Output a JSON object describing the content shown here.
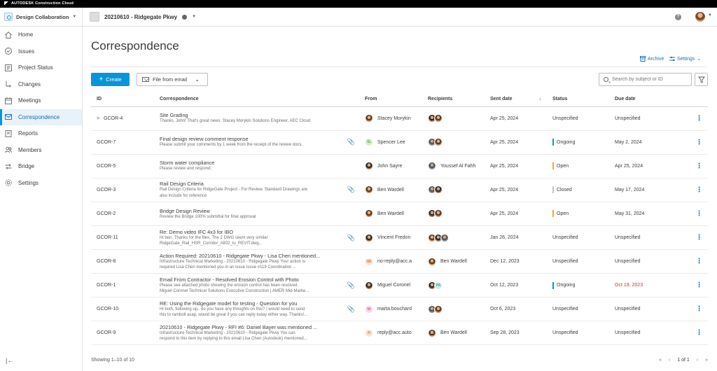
{
  "topbar": {
    "brand": "AUTODESK Construction Cloud"
  },
  "header": {
    "product": "Design Collaboration",
    "project": "20210610 - Ridgegate Pkwy",
    "help": "?"
  },
  "sidebar": {
    "items": [
      {
        "label": "Home",
        "icon": "home-icon"
      },
      {
        "label": "Issues",
        "icon": "issues-icon"
      },
      {
        "label": "Project Status",
        "icon": "project-status-icon"
      },
      {
        "label": "Changes",
        "icon": "changes-icon"
      },
      {
        "label": "Meetings",
        "icon": "meetings-icon"
      },
      {
        "label": "Correspondence",
        "icon": "correspondence-icon",
        "active": true
      },
      {
        "label": "Reports",
        "icon": "reports-icon"
      },
      {
        "label": "Members",
        "icon": "members-icon"
      },
      {
        "label": "Bridge",
        "icon": "bridge-icon"
      },
      {
        "label": "Settings",
        "icon": "settings-icon"
      }
    ],
    "collapse": "|←"
  },
  "main": {
    "title": "Correspondence",
    "archive": "Archive",
    "settings": "Settings",
    "create": "Create",
    "file_from_email": "File from email",
    "search_placeholder": "Search by subject or ID",
    "columns": [
      "ID",
      "Correspondence",
      "From",
      "Recipients",
      "Sent date",
      "Status",
      "Due date"
    ],
    "rows": [
      {
        "id": "GCOR-4",
        "expand": ">",
        "subject": "Site Grading",
        "snippet1": "Thanks, John! That's great news. Stacey Morykin Solutions Engineer, AEC Cloud",
        "snippet2": "",
        "attach": false,
        "from": "Stacey Morykin",
        "from_initials": "",
        "from_av": "photo",
        "recipients": [
          "photo2",
          "photo"
        ],
        "recip_name": "",
        "sent": "Apr 25, 2024",
        "status": "Unspecified",
        "status_color": "",
        "due": "Unspecified",
        "due_overdue": false
      },
      {
        "id": "GCOR-7",
        "expand": "",
        "subject": "Final design review comment response",
        "snippet1": "Please submit your comments by 1 week from the receipt of the review docs.",
        "snippet2": "",
        "attach": true,
        "from": "Spencer Lee",
        "from_initials": "SL",
        "from_av": "init-green",
        "recipients": [
          "photo3",
          "photo"
        ],
        "recip_name": "",
        "sent": "Apr 25, 2024",
        "status": "Ongoing",
        "status_color": "#0696d7",
        "due": "May 2, 2024",
        "due_overdue": false
      },
      {
        "id": "GCOR-5",
        "expand": "",
        "subject": "Storm water compliance",
        "snippet1": "Please review and respond.",
        "snippet2": "",
        "attach": false,
        "from": "John Sayre",
        "from_initials": "",
        "from_av": "photo2",
        "recipients": [
          "photo3"
        ],
        "recip_name": "Youssef Al Fahh",
        "sent": "Apr 25, 2024",
        "status": "Open",
        "status_color": "#f5a623",
        "due": "Apr 25, 2024",
        "due_overdue": false
      },
      {
        "id": "GCOR-3",
        "expand": "",
        "subject": "Rail Design Criteria",
        "snippet1": "Rail Design Criteria for RidgeGate Project - For Review. Standard Drawings are",
        "snippet2": "also include for reference",
        "attach": true,
        "from": "Ben Wardell",
        "from_initials": "",
        "from_av": "photo",
        "recipients": [
          "photo3",
          "photo2"
        ],
        "recip_name": "",
        "sent": "Apr 25, 2024",
        "status": "Closed",
        "status_color": "#c4c4c4",
        "due": "May 17, 2024",
        "due_overdue": false
      },
      {
        "id": "GCOR-2",
        "expand": "",
        "subject": "Bridge Design Review",
        "snippet1": "Review the Bridge 100% submittal for final approval",
        "snippet2": "",
        "attach": false,
        "from": "Ben Wardell",
        "from_initials": "",
        "from_av": "photo",
        "recipients": [
          "photo2",
          "photo"
        ],
        "recip_name": "",
        "sent": "Apr 25, 2024",
        "status": "Open",
        "status_color": "#f5a623",
        "due": "May 31, 2024",
        "due_overdue": false
      },
      {
        "id": "GCOR-11",
        "expand": "",
        "subject": "Re: Demo video IFC 4x3 for IBO",
        "snippet1": "Hi ben, Thanks for the files. The 2 DWG seem very similar",
        "snippet2": "RidgeGate_Rail_HSR_Corridor_Alt02_to_REVIT.dwg...",
        "attach": true,
        "from": "Vincent Fredon",
        "from_initials": "",
        "from_av": "photo2",
        "recipients": [
          "photo",
          "photo2",
          "photo3"
        ],
        "recip_name": "",
        "sent": "Jan 26, 2024",
        "status": "Unspecified",
        "status_color": "",
        "due": "Unspecified",
        "due_overdue": false
      },
      {
        "id": "GCOR-8",
        "expand": "",
        "subject": "Action Required: 20210610 - Ridgegate Pkwy - Lisa Chen mentioned...",
        "snippet1": "Infrastructure Technical Marketing - 20210610 - Ridgegate Pkwy Your action is",
        "snippet2": "required Lisa Chen mentioned you in an issue  Issue #119 Coordination ...",
        "attach": false,
        "from": "no-reply@acc.a",
        "from_initials": "NR",
        "from_av": "init-orange",
        "recipients": [
          "photo"
        ],
        "recip_name": "Ben Wardell",
        "sent": "Dec 12, 2023",
        "status": "Unspecified",
        "status_color": "",
        "due": "Unspecified",
        "due_overdue": false
      },
      {
        "id": "GCOR-1",
        "expand": "",
        "subject": "Email From Contractor - Resolved Erosion Control with Photo",
        "snippet1": "Please see attached photo showing the erosion control has been resolved.",
        "snippet2": "Miguel Coronel Technical Solutions Executive Construction | AMER Mid-Marke...",
        "attach": true,
        "from": "Miguel Coronel",
        "from_initials": "",
        "from_av": "photo2",
        "recipients": [
          "photo2",
          "init-teal"
        ],
        "recip_name": "",
        "sent": "Oct 12, 2023",
        "status": "Ongoing",
        "status_color": "#0696d7",
        "due": "Oct 19, 2023",
        "due_overdue": true
      },
      {
        "id": "GCOR-10",
        "expand": "",
        "subject": "RE: Using the Ridgegate model for testing - Question for you",
        "snippet1": "Hi both, following up.. do you have any thoughts on this? I would need to send",
        "snippet2": "this to ramboll asap, would be great if you can reply today either way. Thanks!...",
        "attach": true,
        "from": "marta.bouchard",
        "from_initials": "M",
        "from_av": "init-pink",
        "recipients": [
          "photo3",
          "photo"
        ],
        "recip_name": "",
        "sent": "Oct 6, 2023",
        "status": "Unspecified",
        "status_color": "",
        "due": "Unspecified",
        "due_overdue": false
      },
      {
        "id": "GCOR-9",
        "expand": "",
        "subject": "20210610 - Ridgegate Pkwy - RFI #6: Daniel Bayer was mentioned ...",
        "snippet1": "Infrastructure Technical Marketing - 20210610 - Ridgegate Pkwy You can",
        "snippet2": "respond to this item by replying to this email Lisa Chen (Autodesk) mentioned...",
        "attach": false,
        "from": "reply@acc.auto",
        "from_initials": "R",
        "from_av": "init-orange",
        "recipients": [
          "photo"
        ],
        "recip_name": "Ben Wardell",
        "sent": "Sep 28, 2023",
        "status": "Unspecified",
        "status_color": "",
        "due": "Unspecified",
        "due_overdue": false
      }
    ],
    "footer": "Showing 1–10 of 10",
    "page_label": "1 of 1"
  }
}
